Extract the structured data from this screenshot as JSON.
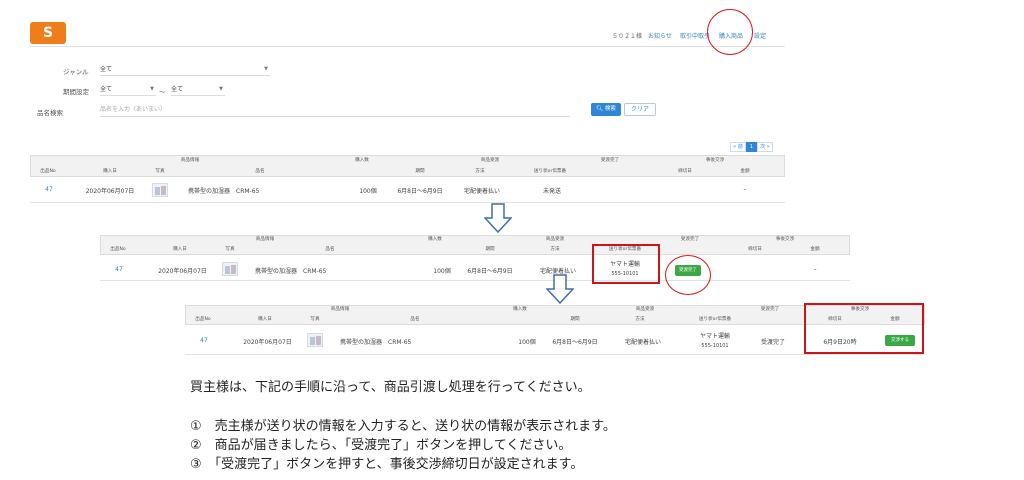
{
  "header": {
    "logo_text": "S",
    "user": "５０２１様",
    "nav_items": [
      "お知らせ",
      "取引中取引",
      "購入商品",
      "設定"
    ]
  },
  "search": {
    "genre_label": "ジャンル",
    "genre_value": "全て",
    "period_label": "期間設定",
    "period_from": "全て",
    "period_sep": "〜",
    "period_to": "全て",
    "keyword_label": "品名検索",
    "keyword_placeholder": "品名を入力（あいまい）",
    "search_button": "検索",
    "clear_button": "クリア"
  },
  "pager": {
    "prev": "« 前",
    "page": "1",
    "next": "次 »"
  },
  "table": {
    "groups": {
      "product_info": "商品情報",
      "qty": "購入数",
      "delivery": "商品受渡",
      "complete": "受渡完了",
      "negotiation": "事後交渉"
    },
    "columns": {
      "no": "出品No",
      "date": "購入日",
      "photo": "写真",
      "name": "品名",
      "schedule": "期間",
      "method": "方法",
      "waybill": "送り状or伝票番",
      "deadline": "締切日",
      "amount": "金額"
    }
  },
  "rows": [
    {
      "no": "47",
      "date": "2020年06月07日",
      "name": "携帯型の加湿器　CRM-65",
      "qty": "100個",
      "schedule": "6月8日〜6月9日",
      "method": "宅配便着払い",
      "waybill": "未発送",
      "complete": "",
      "negotiation": "–"
    },
    {
      "no": "47",
      "date": "2020年06月07日",
      "name": "携帯型の加湿器　CRM-65",
      "qty": "100個",
      "schedule": "6月8日〜6月9日",
      "method": "宅配便着払い",
      "waybill_1": "ヤマト運輸",
      "waybill_2": "555-10101",
      "complete_button": "受渡完了",
      "negotiation": "–"
    },
    {
      "no": "47",
      "date": "2020年06月07日",
      "name": "携帯型の加湿器　CRM-65",
      "qty": "100個",
      "schedule": "6月8日〜6月9日",
      "method": "宅配便着払い",
      "waybill_1": "ヤマト運輸",
      "waybill_2": "555-10101",
      "complete": "受渡完了",
      "deadline": "6月9日20時",
      "negotiation_button": "交渉する"
    }
  ],
  "instructions": {
    "intro": "買主様は、下記の手順に沿って、商品引渡し処理を行ってください。",
    "steps": [
      "①　売主様が送り状の情報を入力すると、送り状の情報が表示されます。",
      "②　商品が届きましたら、「受渡完了」ボタンを押してください。",
      "③　「受渡完了」ボタンを押すと、事後交渉締切日が設定されます。"
    ]
  },
  "colors": {
    "accent": "#2f86d6",
    "logo": "#ef7d1a",
    "highlight": "#c8161c",
    "green": "#3aa845"
  }
}
